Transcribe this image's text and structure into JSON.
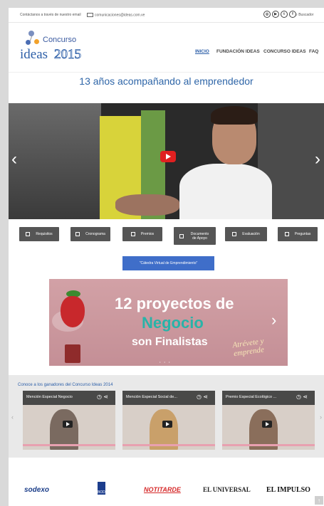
{
  "topbar": {
    "contact_text": "Contáctanos a través de nuestro email",
    "email": "comunicaciones@ideas.com.ve",
    "social_icons": [
      "instagram-icon",
      "youtube-icon",
      "twitter-icon",
      "facebook-icon"
    ],
    "social_glyphs": [
      "◎",
      "▶",
      "t",
      "f"
    ],
    "search_label": "Buscador"
  },
  "logo": {
    "top": "Concurso",
    "ideas": "ideas",
    "year": "2015"
  },
  "nav": {
    "items": [
      "INICIO",
      "FUNDACIÓN IDEAS",
      "CONCURSO IDEAS",
      "FAQ"
    ],
    "active": "INICIO"
  },
  "headline": "13 años acompañando al emprendedor",
  "buttons": [
    {
      "label": "Requisitos"
    },
    {
      "label": "Cronograma"
    },
    {
      "label": "Premios"
    },
    {
      "label": "Documento de Apoyo"
    },
    {
      "label": "Evaluación"
    },
    {
      "label": "Preguntas"
    }
  ],
  "catedra_label": "\"Cátedra Virtual de Emprendimiento\"",
  "banner": {
    "line1": "12 proyectos de",
    "line2": "Negocio",
    "line3": "son Finalistas",
    "slogan": "Atrévete y emprende"
  },
  "winners": {
    "title": "Conoce a los ganadores del Concurso Ideas 2014",
    "videos": [
      {
        "title": "Mención Especial Negocio"
      },
      {
        "title": "Mención Especial Social de..."
      },
      {
        "title": "Premio Especial Ecológico ..."
      }
    ]
  },
  "sponsors": [
    "sodexo",
    "BOD",
    "NOTITARDE",
    "EL UNIVERSAL",
    "EL IMPULSO"
  ],
  "colors": {
    "brand": "#2d5fa8",
    "button": "#555555",
    "accent": "#3f6ec9",
    "play": "#e02020"
  }
}
